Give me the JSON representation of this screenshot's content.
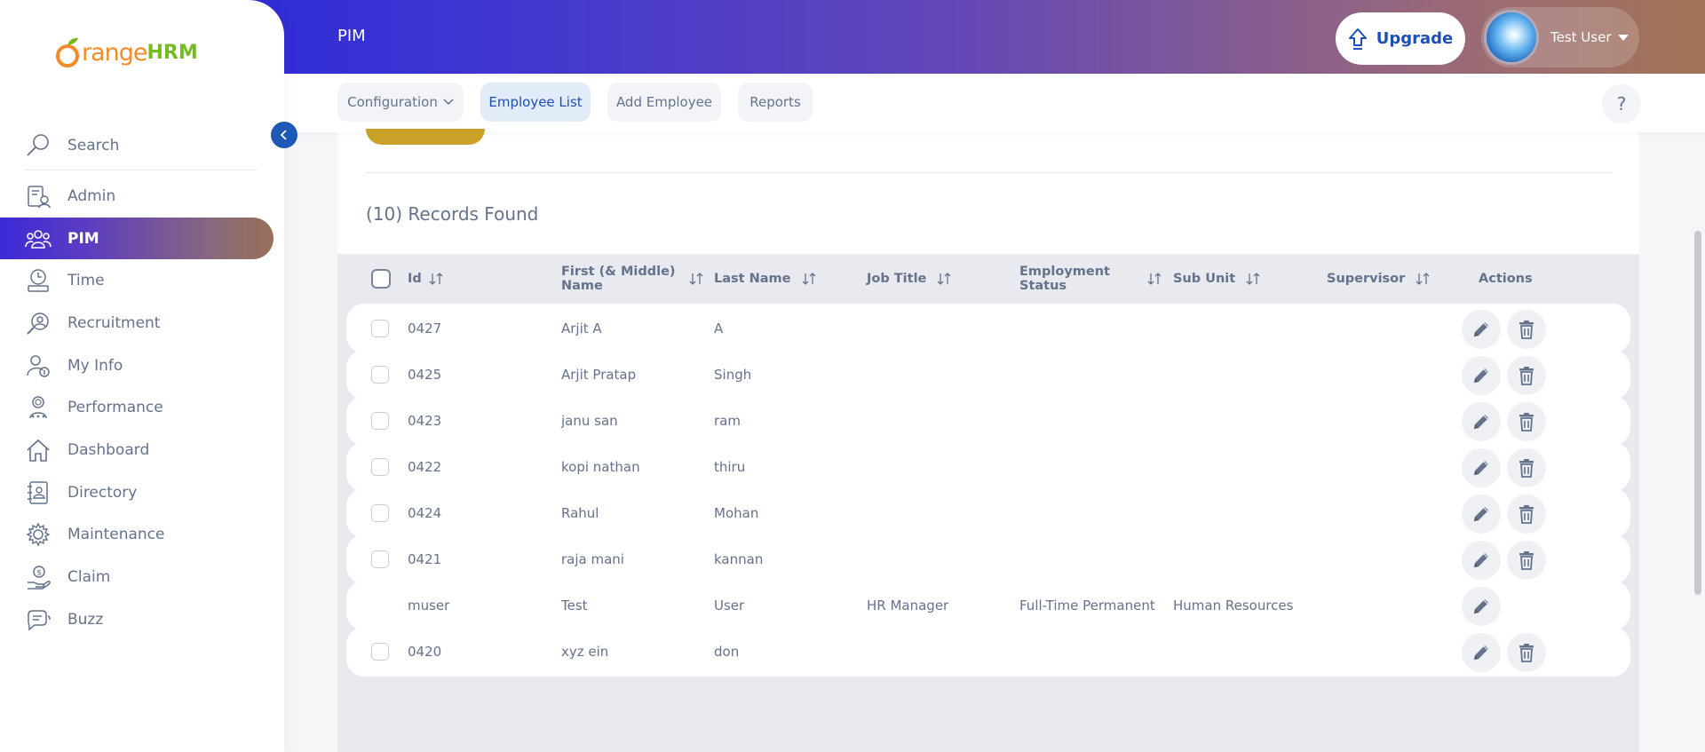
{
  "brand": {
    "logo_part1": "range",
    "logo_part2": "HRM"
  },
  "sidebar": {
    "search_label": "Search",
    "items": [
      {
        "label": "Admin",
        "icon": "admin-icon"
      },
      {
        "label": "PIM",
        "icon": "pim-icon",
        "active": true
      },
      {
        "label": "Time",
        "icon": "time-icon"
      },
      {
        "label": "Recruitment",
        "icon": "recruitment-icon"
      },
      {
        "label": "My Info",
        "icon": "my-info-icon"
      },
      {
        "label": "Performance",
        "icon": "performance-icon"
      },
      {
        "label": "Dashboard",
        "icon": "dashboard-icon"
      },
      {
        "label": "Directory",
        "icon": "directory-icon"
      },
      {
        "label": "Maintenance",
        "icon": "maintenance-icon"
      },
      {
        "label": "Claim",
        "icon": "claim-icon"
      },
      {
        "label": "Buzz",
        "icon": "buzz-icon"
      }
    ]
  },
  "header": {
    "module": "PIM",
    "upgrade_label": "Upgrade",
    "user_name": "Test User"
  },
  "subnav": {
    "tabs": [
      {
        "label": "Configuration"
      },
      {
        "label": "Employee List",
        "active": true
      },
      {
        "label": "Add Employee"
      },
      {
        "label": "Reports"
      }
    ],
    "help_label": "?"
  },
  "main": {
    "records_found": "(10) Records Found",
    "columns": [
      "Id",
      "First (& Middle) Name",
      "Last Name",
      "Job Title",
      "Employment Status",
      "Sub Unit",
      "Supervisor",
      "Actions"
    ],
    "column_lines": {
      "first_name_1": "First (& Middle)",
      "first_name_2": "Name",
      "employment_1": "Employment",
      "employment_2": "Status"
    },
    "rows": [
      {
        "id": "0427",
        "first": "Arjit A",
        "last": "A",
        "job": "",
        "status": "",
        "subunit": "",
        "supervisor": "",
        "selectable": true,
        "deletable": true
      },
      {
        "id": "0425",
        "first": "Arjit Pratap",
        "last": "Singh",
        "job": "",
        "status": "",
        "subunit": "",
        "supervisor": "",
        "selectable": true,
        "deletable": true
      },
      {
        "id": "0423",
        "first": "janu san",
        "last": "ram",
        "job": "",
        "status": "",
        "subunit": "",
        "supervisor": "",
        "selectable": true,
        "deletable": true
      },
      {
        "id": "0422",
        "first": "kopi nathan",
        "last": "thiru",
        "job": "",
        "status": "",
        "subunit": "",
        "supervisor": "",
        "selectable": true,
        "deletable": true
      },
      {
        "id": "0424",
        "first": "Rahul",
        "last": "Mohan",
        "job": "",
        "status": "",
        "subunit": "",
        "supervisor": "",
        "selectable": true,
        "deletable": true
      },
      {
        "id": "0421",
        "first": "raja mani",
        "last": "kannan",
        "job": "",
        "status": "",
        "subunit": "",
        "supervisor": "",
        "selectable": true,
        "deletable": true
      },
      {
        "id": "muser",
        "first": "Test",
        "last": "User",
        "job": "HR Manager",
        "status": "Full-Time Permanent",
        "subunit": "Human Resources",
        "supervisor": "",
        "selectable": false,
        "deletable": false
      },
      {
        "id": "0420",
        "first": "xyz ein",
        "last": "don",
        "job": "",
        "status": "",
        "subunit": "",
        "supervisor": "",
        "selectable": true,
        "deletable": true
      }
    ]
  },
  "colors": {
    "primary": "#1e50b4",
    "accent_orange": "#f28c28",
    "accent_green": "#76bc21",
    "add_button": "#c9a128"
  }
}
